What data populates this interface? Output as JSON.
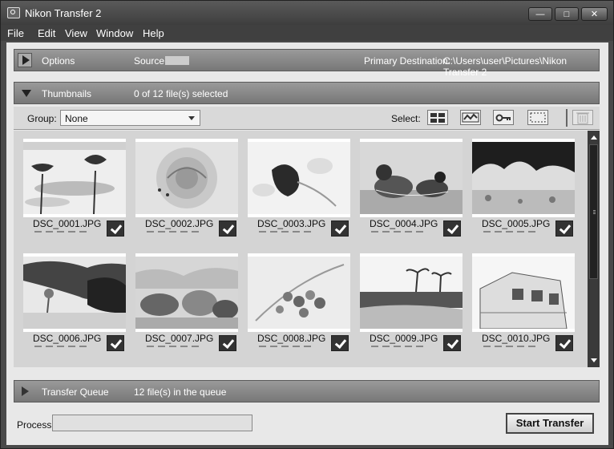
{
  "window": {
    "title": "Nikon Transfer 2"
  },
  "menu": [
    "File",
    "Edit",
    "View",
    "Window",
    "Help"
  ],
  "options_panel": {
    "label": "Options",
    "source_label": "Source:",
    "destination_label": "Primary Destination:",
    "destination_path": "C:\\Users\\user\\Pictures\\Nikon Transfer 2"
  },
  "thumbnails_panel": {
    "label": "Thumbnails",
    "selection_status": "0 of 12 file(s) selected"
  },
  "toolbar": {
    "group_label": "Group:",
    "group_value": "None",
    "select_label": "Select:"
  },
  "files": [
    {
      "name": "DSC_0001.JPG",
      "checked": true
    },
    {
      "name": "DSC_0002.JPG",
      "checked": true
    },
    {
      "name": "DSC_0003.JPG",
      "checked": true
    },
    {
      "name": "DSC_0004.JPG",
      "checked": true
    },
    {
      "name": "DSC_0005.JPG",
      "checked": true
    },
    {
      "name": "DSC_0006.JPG",
      "checked": true
    },
    {
      "name": "DSC_0007.JPG",
      "checked": true
    },
    {
      "name": "DSC_0008.JPG",
      "checked": true
    },
    {
      "name": "DSC_0009.JPG",
      "checked": true
    },
    {
      "name": "DSC_0010.JPG",
      "checked": true
    }
  ],
  "transfer_queue": {
    "label": "Transfer Queue",
    "status": "12 file(s) in the queue"
  },
  "footer": {
    "process_label": "Process:",
    "start_button": "Start Transfer"
  }
}
